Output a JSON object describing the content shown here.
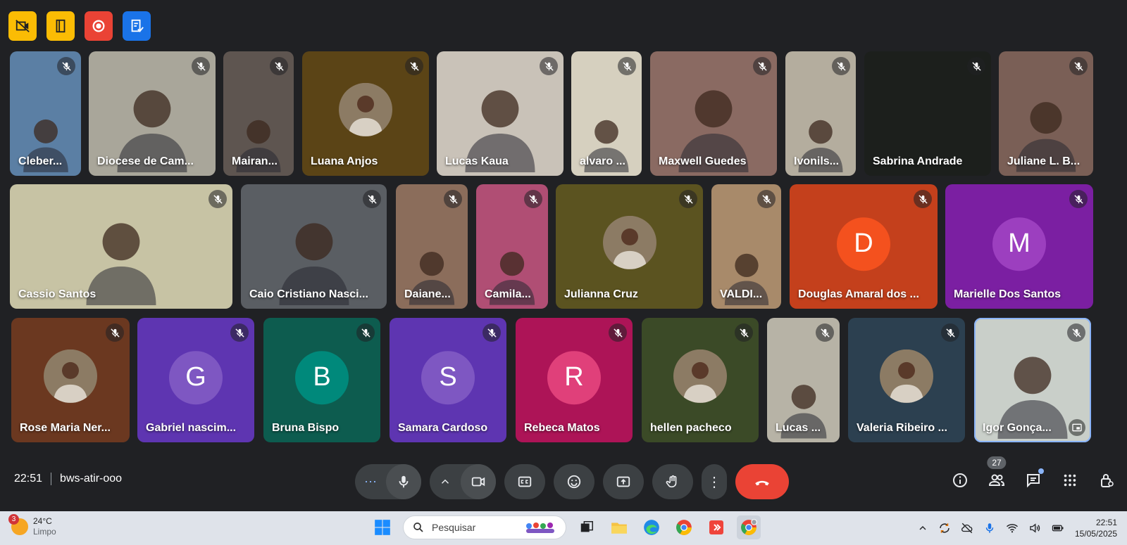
{
  "ext_buttons": [
    {
      "icon": "no-video-icon",
      "color": "#fbbc04"
    },
    {
      "icon": "door-icon",
      "color": "#fbbc04"
    },
    {
      "icon": "record-icon",
      "color": "#ea4335"
    },
    {
      "icon": "notes-icon",
      "color": "#1a73e8"
    }
  ],
  "participants": [
    {
      "name": "Cleber...",
      "type": "video",
      "bg": "#5b7fa4"
    },
    {
      "name": "Diocese de Cam...",
      "type": "video",
      "bg": "#a9a69a"
    },
    {
      "name": "Mairan...",
      "type": "video",
      "bg": "#5e5550"
    },
    {
      "name": "Luana Anjos",
      "type": "photo",
      "bg": "#5b4416"
    },
    {
      "name": "Lucas Kaua",
      "type": "video",
      "bg": "#c9c2b8"
    },
    {
      "name": "alvaro ...",
      "type": "video",
      "bg": "#d6d0bf"
    },
    {
      "name": "Maxwell Guedes",
      "type": "video",
      "bg": "#8a6a62"
    },
    {
      "name": "Ivonils...",
      "type": "video",
      "bg": "#b4ad9e"
    },
    {
      "name": "Sabrina Andrade",
      "type": "empty",
      "bg": "#1c1f1c"
    },
    {
      "name": "Juliane L. B...",
      "type": "video",
      "bg": "#7a5f56"
    },
    {
      "name": "Cassio Santos",
      "type": "video",
      "bg": "#c7c3a4"
    },
    {
      "name": "Caio Cristiano Nasci...",
      "type": "video",
      "bg": "#5a5e63"
    },
    {
      "name": "Daiane...",
      "type": "video",
      "bg": "#8b6d5b"
    },
    {
      "name": "Camila...",
      "type": "video",
      "bg": "#b04e74"
    },
    {
      "name": "Julianna Cruz",
      "type": "photo",
      "bg": "#5b5320"
    },
    {
      "name": "VALDI...",
      "type": "video",
      "bg": "#a88a6a"
    },
    {
      "name": "Douglas Amaral dos ...",
      "type": "letter",
      "letter": "D",
      "bg": "#c4401c",
      "circle": "#f4511e"
    },
    {
      "name": "Marielle Dos Santos",
      "type": "letter",
      "letter": "M",
      "bg": "#7b1fa2",
      "circle": "#9c3fbf"
    },
    {
      "name": "Rose Maria Ner...",
      "type": "photo",
      "bg": "#6b3820"
    },
    {
      "name": "Gabriel nascim...",
      "type": "letter",
      "letter": "G",
      "bg": "#5e35b1",
      "circle": "#7e57c2"
    },
    {
      "name": "Bruna Bispo",
      "type": "letter",
      "letter": "B",
      "bg": "#0d5c4f",
      "circle": "#00897b"
    },
    {
      "name": "Samara Cardoso",
      "type": "letter",
      "letter": "S",
      "bg": "#5e35b1",
      "circle": "#7e57c2"
    },
    {
      "name": "Rebeca Matos",
      "type": "letter",
      "letter": "R",
      "bg": "#ad1457",
      "circle": "#e0407a"
    },
    {
      "name": "hellen pacheco",
      "type": "photo",
      "bg": "#3b4a27"
    },
    {
      "name": "Lucas ...",
      "type": "video",
      "bg": "#b7b3a6"
    },
    {
      "name": "Valeria Ribeiro ...",
      "type": "photo",
      "bg": "#2c4050"
    },
    {
      "name": "Igor Gonça...",
      "type": "video",
      "bg": "#c9cfc9",
      "selected": true
    }
  ],
  "meeting": {
    "time": "22:51",
    "code": "bws-atir-ooo"
  },
  "controls": {
    "more_options_label": "⋯",
    "more_label": "⋮"
  },
  "right_panel": {
    "participant_count": "27"
  },
  "taskbar": {
    "weather_badge": "3",
    "temperature": "24°C",
    "condition": "Limpo",
    "search_placeholder": "Pesquisar",
    "clock_time": "22:51",
    "clock_date": "15/05/2025"
  }
}
